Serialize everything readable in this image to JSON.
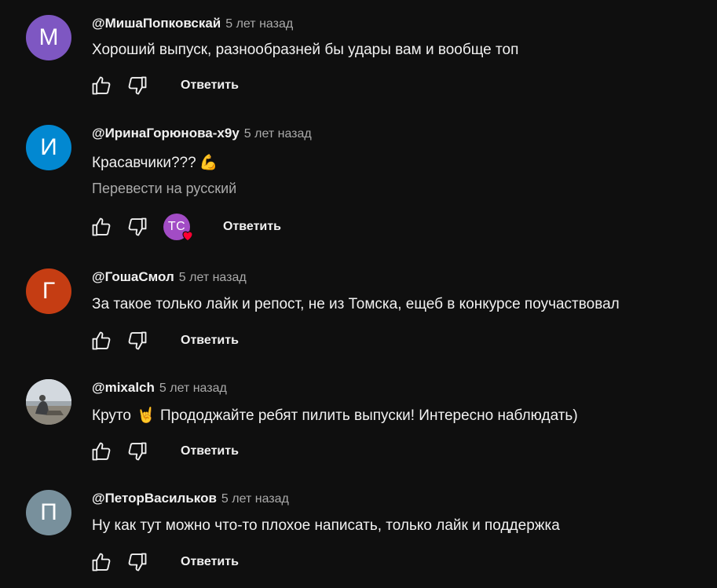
{
  "comments": [
    {
      "avatar_letter": "М",
      "avatar_color": "#7e57c2",
      "author": "@МишаПопковскай",
      "time": "5 лет назад",
      "text": "Хороший выпуск, разнообразней бы удары вам и вообще топ",
      "reply_label": "Ответить"
    },
    {
      "avatar_letter": "И",
      "avatar_color": "#0288d1",
      "author": "@ИринаГорюнова-х9у",
      "time": "5 лет назад",
      "text": "Красавчики???",
      "emoji": "💪",
      "translate_label": "Перевести на русский",
      "creator_initials": "TC",
      "creator_heart_color": "#ff0033",
      "reply_label": "Ответить"
    },
    {
      "avatar_letter": "Г",
      "avatar_color": "#c53d13",
      "author": "@ГошаСмол",
      "time": "5 лет назад",
      "text": "За такое только лайк и репост, не из Томска, ещеб в конкурсе поучаствовал",
      "reply_label": "Ответить"
    },
    {
      "avatar_letter": "",
      "avatar_color": "#b9c0c6",
      "author": "@mixalch",
      "time": "5 лет назад",
      "text_before": "Круто",
      "emoji": "🤘",
      "text_after": "Прододжайте ребят пилить выпуски! Интересно наблюдать)",
      "reply_label": "Ответить"
    },
    {
      "avatar_letter": "П",
      "avatar_color": "#78909c",
      "author": "@ПеторВасильков",
      "time": "5 лет назад",
      "text": "Ну как тут можно что-то плохое написать, только лайк и поддержка",
      "reply_label": "Ответить"
    }
  ],
  "icons": {
    "like": "thumbs-up-icon",
    "dislike": "thumbs-down-icon",
    "heart": "heart-icon"
  },
  "colors": {
    "background": "#0f0f0f",
    "primary_text": "#f1f1f1",
    "secondary_text": "#aaaaaa"
  }
}
